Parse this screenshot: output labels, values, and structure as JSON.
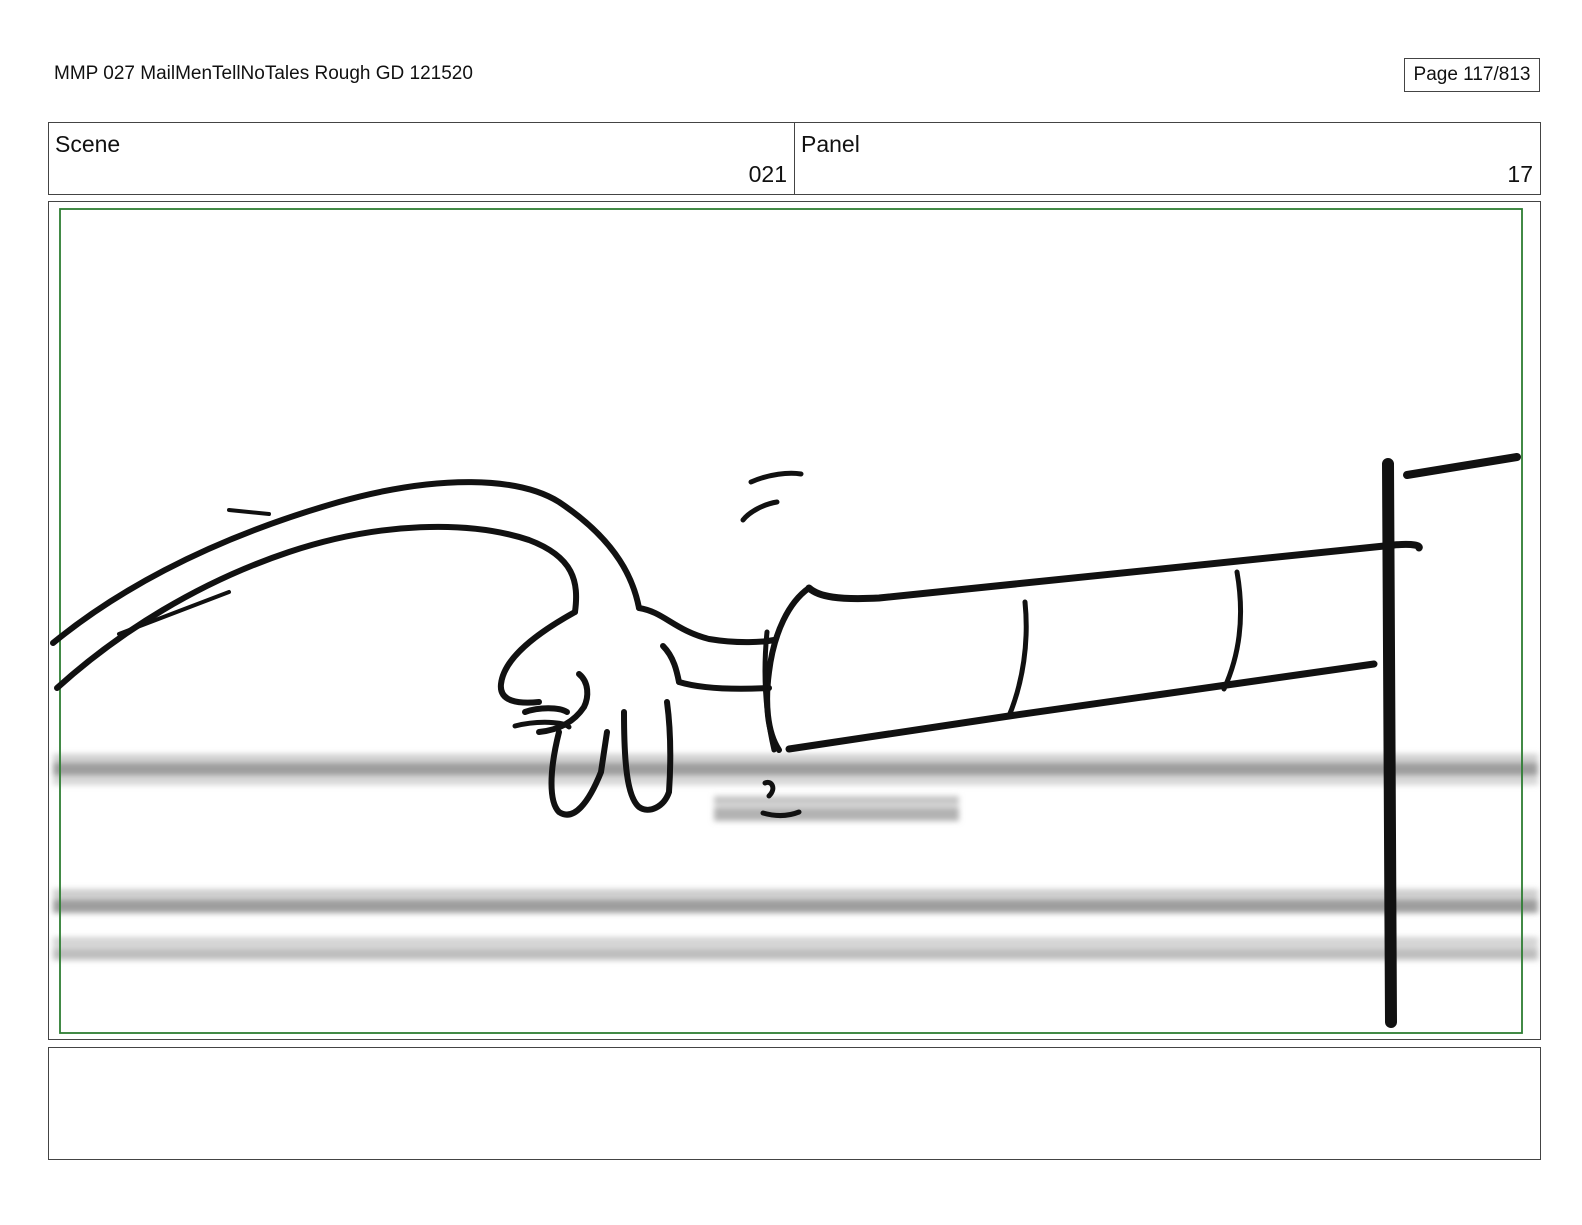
{
  "header": {
    "document_title": "MMP 027 MailMenTellNoTales Rough GD 121520",
    "page_counter": "Page 117/813"
  },
  "info": {
    "scene_label": "Scene",
    "scene_value": "021",
    "panel_label": "Panel",
    "panel_value": "17"
  },
  "panel": {
    "safe_frame_color": "#2e7d32",
    "ink_color": "#111111",
    "blur_band_color": "#9e9e9e"
  },
  "notes": {
    "text": ""
  }
}
